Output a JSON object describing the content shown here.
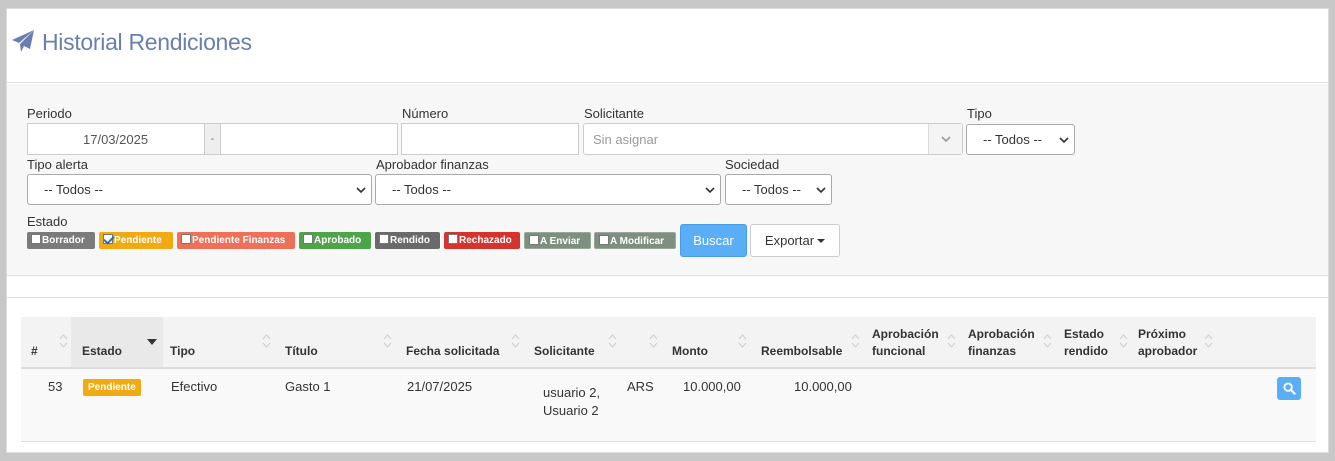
{
  "header": {
    "title": "Historial Rendiciones",
    "icon": "paper-plane-icon"
  },
  "filters": {
    "periodo": {
      "label": "Periodo",
      "from": "17/03/2025",
      "separator": "-",
      "to": ""
    },
    "numero": {
      "label": "Número",
      "value": ""
    },
    "solicitante": {
      "label": "Solicitante",
      "placeholder": "Sin asignar"
    },
    "tipo": {
      "label": "Tipo",
      "selected": "-- Todos --"
    },
    "tipo_alerta": {
      "label": "Tipo alerta",
      "selected": "-- Todos --"
    },
    "aprobador_finanzas": {
      "label": "Aprobador finanzas",
      "selected": "-- Todos --"
    },
    "sociedad": {
      "label": "Sociedad",
      "selected": "-- Todos --"
    },
    "estado": {
      "label": "Estado",
      "chips": [
        {
          "label": "Borrador",
          "color": "#7b7b7b",
          "checked": false
        },
        {
          "label": "Pendiente",
          "color": "#f2aa12",
          "checked": true
        },
        {
          "label": "Pendiente Finanzas",
          "color": "#ee7058",
          "checked": false
        },
        {
          "label": "Aprobado",
          "color": "#4ea548",
          "checked": false
        },
        {
          "label": "Rendido",
          "color": "#6a6a6a",
          "checked": false
        },
        {
          "label": "Rechazado",
          "color": "#d6322e",
          "checked": false
        },
        {
          "label": "A Enviar",
          "color": "#7f8f7f",
          "checked": false
        },
        {
          "label": "A Modificar",
          "color": "#7f8f7f",
          "checked": false
        }
      ]
    },
    "buscar_label": "Buscar",
    "exportar_label": "Exportar"
  },
  "table": {
    "headers": [
      "#",
      "Estado",
      "Tipo",
      "Título",
      "Fecha solicitada",
      "Solicitante",
      "Monto",
      "Reembolsable",
      "Aprobación funcional",
      "Aprobación finanzas",
      "Estado rendido",
      "Próximo aprobador"
    ],
    "rows": [
      {
        "num": "53",
        "estado": "Pendiente",
        "tipo": "Efectivo",
        "titulo": "Gasto 1",
        "fecha": "21/07/2025",
        "solicitante": "usuario 2, Usuario 2",
        "moneda": "ARS",
        "monto": "10.000,00",
        "reembolsable": "10.000,00"
      }
    ]
  },
  "colors": {
    "accent": "#5aaef5",
    "title": "#6a7fb0",
    "pending": "#f2aa12"
  }
}
